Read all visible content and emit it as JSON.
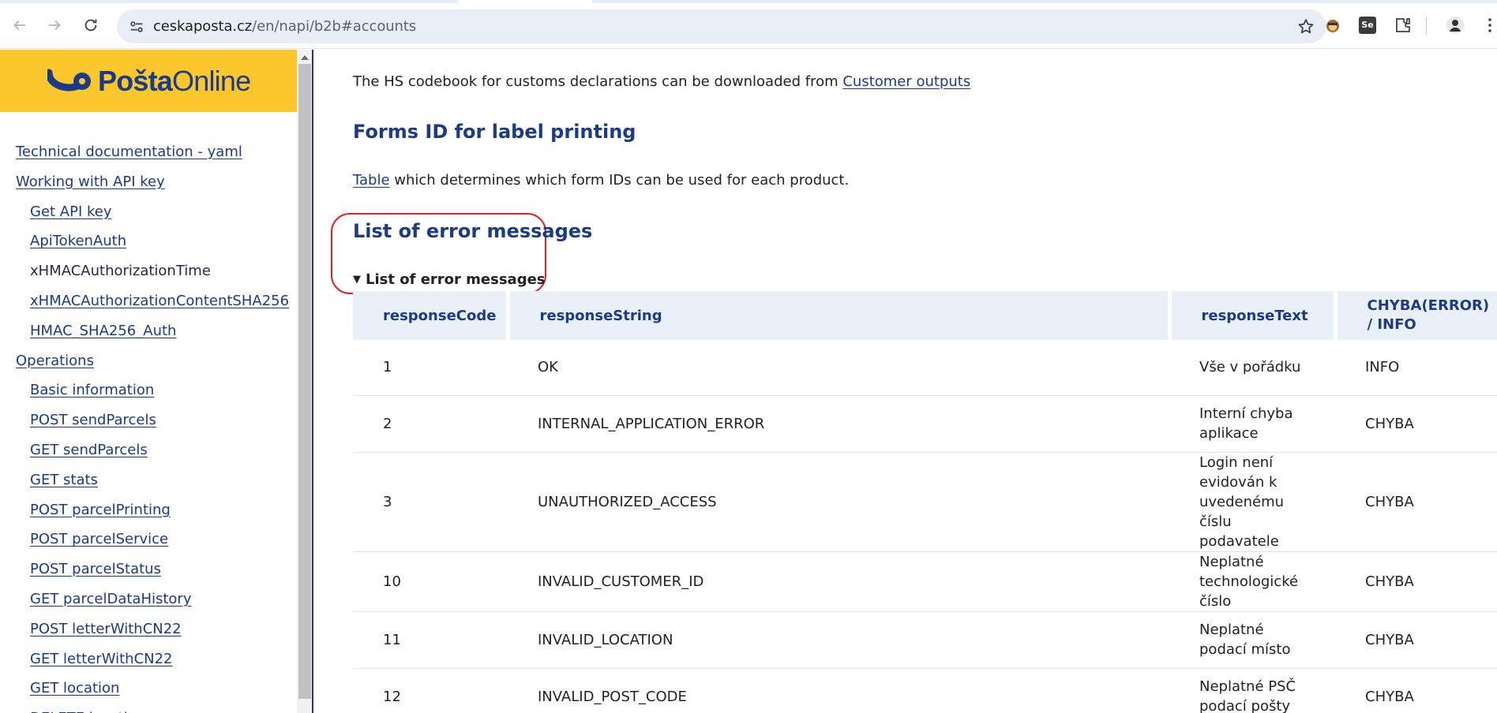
{
  "browser": {
    "url_host": "ceskaposta.cz",
    "url_path": "/en/napi/b2b#accounts"
  },
  "sidebar": {
    "logo_prefix": "Pošta",
    "logo_suffix": "Online",
    "items": [
      {
        "label": "Technical documentation - yaml",
        "level": 0,
        "link": true
      },
      {
        "label": "Working with API key",
        "level": 0,
        "link": true
      },
      {
        "label": "Get API key",
        "level": 1,
        "link": true
      },
      {
        "label": "ApiTokenAuth",
        "level": 1,
        "link": true
      },
      {
        "label": "xHMACAuthorizationTime",
        "level": 1,
        "link": false
      },
      {
        "label": "xHMACAuthorizationContentSHA256",
        "level": 1,
        "link": true
      },
      {
        "label": "HMAC_SHA256_Auth",
        "level": 1,
        "link": true
      },
      {
        "label": "Operations",
        "level": 0,
        "link": true
      },
      {
        "label": "Basic information",
        "level": 1,
        "link": true
      },
      {
        "label": "POST sendParcels",
        "level": 1,
        "link": true
      },
      {
        "label": "GET sendParcels",
        "level": 1,
        "link": true
      },
      {
        "label": "GET stats",
        "level": 1,
        "link": true
      },
      {
        "label": "POST parcelPrinting",
        "level": 1,
        "link": true
      },
      {
        "label": "POST parcelService",
        "level": 1,
        "link": true
      },
      {
        "label": "POST parcelStatus",
        "level": 1,
        "link": true
      },
      {
        "label": "GET parcelDataHistory",
        "level": 1,
        "link": true
      },
      {
        "label": "POST letterWithCN22",
        "level": 1,
        "link": true
      },
      {
        "label": "GET letterWithCN22",
        "level": 1,
        "link": true
      },
      {
        "label": "GET location",
        "level": 1,
        "link": true
      },
      {
        "label": "DELETE location",
        "level": 1,
        "link": true
      }
    ]
  },
  "main": {
    "hs_text": "The HS codebook for customs declarations can be downloaded from ",
    "hs_link": "Customer outputs",
    "forms_heading": "Forms ID for label printing",
    "forms_link": "Table",
    "forms_text": " which determines which form IDs can be used for each product.",
    "errors_heading": "List of error messages",
    "errors_summary": "List of error messages",
    "table": {
      "headers": [
        "responseCode",
        "responseString",
        "responseText",
        "CHYBA(ERROR) / INFO"
      ],
      "rows": [
        {
          "code": "1",
          "string": "OK",
          "text": "Vše v pořádku",
          "type": "INFO"
        },
        {
          "code": "2",
          "string": "INTERNAL_APPLICATION_ERROR",
          "text": "Interní chyba aplikace",
          "type": "CHYBA"
        },
        {
          "code": "3",
          "string": "UNAUTHORIZED_ACCESS",
          "text": "Login není evidován k uvedenému číslu podavatele",
          "type": "CHYBA"
        },
        {
          "code": "10",
          "string": "INVALID_CUSTOMER_ID",
          "text": "Neplatné technologické číslo",
          "type": "CHYBA"
        },
        {
          "code": "11",
          "string": "INVALID_LOCATION",
          "text": "Neplatné podací místo",
          "type": "CHYBA"
        },
        {
          "code": "12",
          "string": "INVALID_POST_CODE",
          "text": "Neplatné PSČ podací pošty",
          "type": "CHYBA"
        }
      ]
    }
  },
  "colors": {
    "brand_blue": "#1c3a8a",
    "brand_yellow": "#fcc72c",
    "highlight_red": "#e0232b"
  }
}
